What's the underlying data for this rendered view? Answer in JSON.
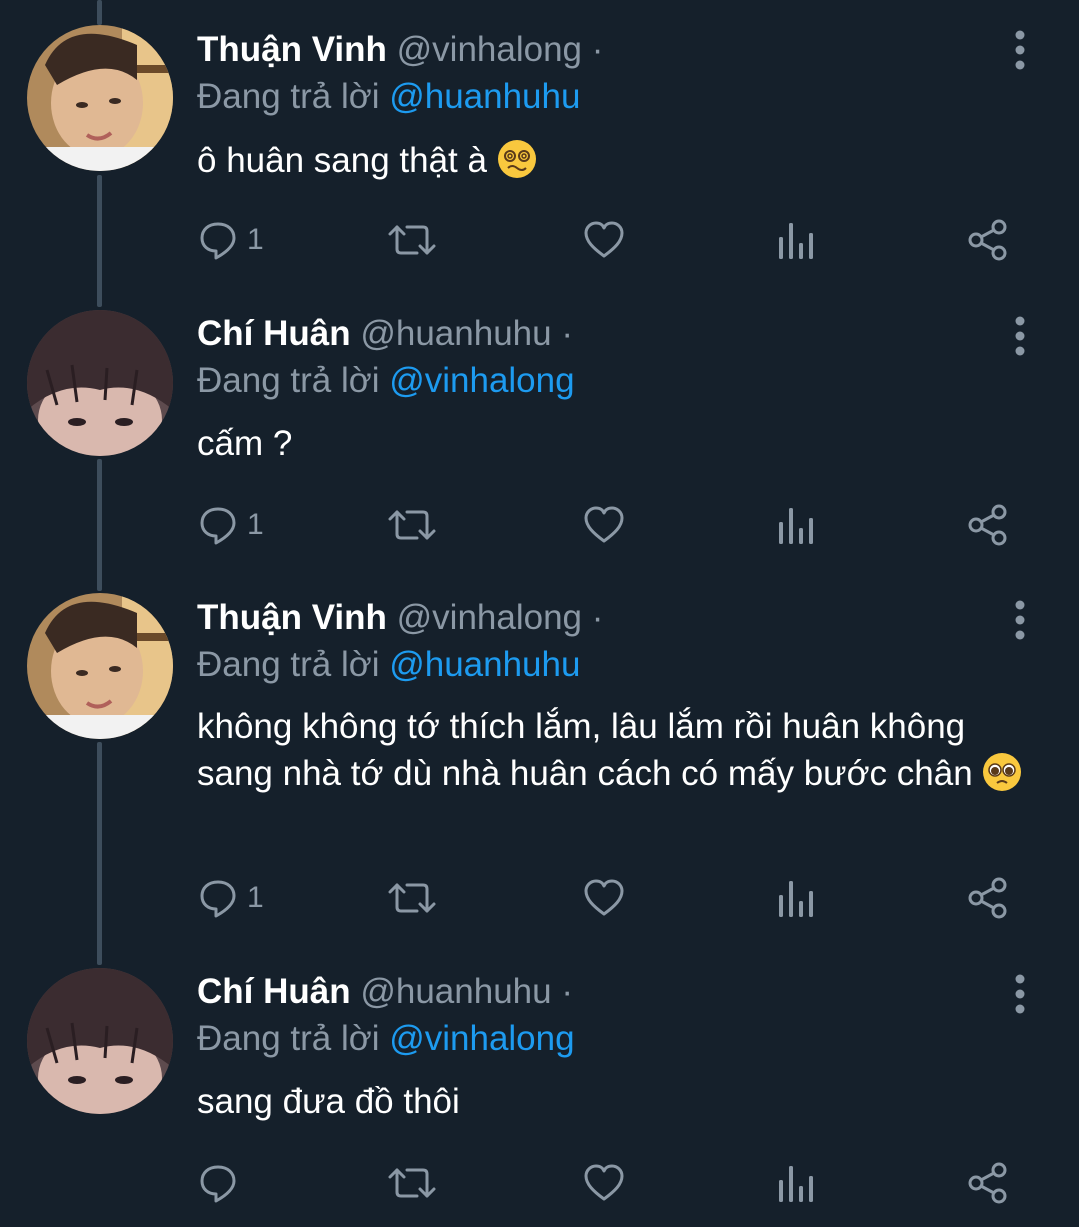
{
  "thread": [
    {
      "name": "Thuận Vinh",
      "handle": "@vinhalong",
      "dot": "·",
      "replying_prefix": "Đang trả lời",
      "replying_to": "@huanhuhu",
      "text": "ô huân sang thật à",
      "emoji": "woozy-face",
      "reply_count": "1",
      "avatar": "person-a"
    },
    {
      "name": "Chí Huân",
      "handle": "@huanhuhu",
      "dot": "·",
      "replying_prefix": "Đang trả lời",
      "replying_to": "@vinhalong",
      "text": "cấm ?",
      "emoji": "",
      "reply_count": "1",
      "avatar": "person-b"
    },
    {
      "name": "Thuận Vinh",
      "handle": "@vinhalong",
      "dot": "·",
      "replying_prefix": "Đang trả lời",
      "replying_to": "@huanhuhu",
      "text": "không không tớ thích lắm, lâu lắm rồi huân không sang nhà tớ dù nhà huân cách có mấy bước chân",
      "emoji": "pleading-face",
      "reply_count": "1",
      "avatar": "person-a"
    },
    {
      "name": "Chí Huân",
      "handle": "@huanhuhu",
      "dot": "·",
      "replying_prefix": "Đang trả lời",
      "replying_to": "@vinhalong",
      "text": "sang đưa đồ thôi",
      "emoji": "",
      "reply_count": "",
      "avatar": "person-b"
    }
  ],
  "icons": {
    "reply": "reply-icon",
    "retweet": "retweet-icon",
    "like": "heart-icon",
    "analytics": "analytics-icon",
    "share": "share-icon",
    "more": "more-vertical-icon"
  },
  "colors": {
    "background": "#15202b",
    "text_primary": "#ffffff",
    "text_secondary": "#8b98a5",
    "mention": "#1d9bf0",
    "thread_line": "#3d4d5c"
  }
}
